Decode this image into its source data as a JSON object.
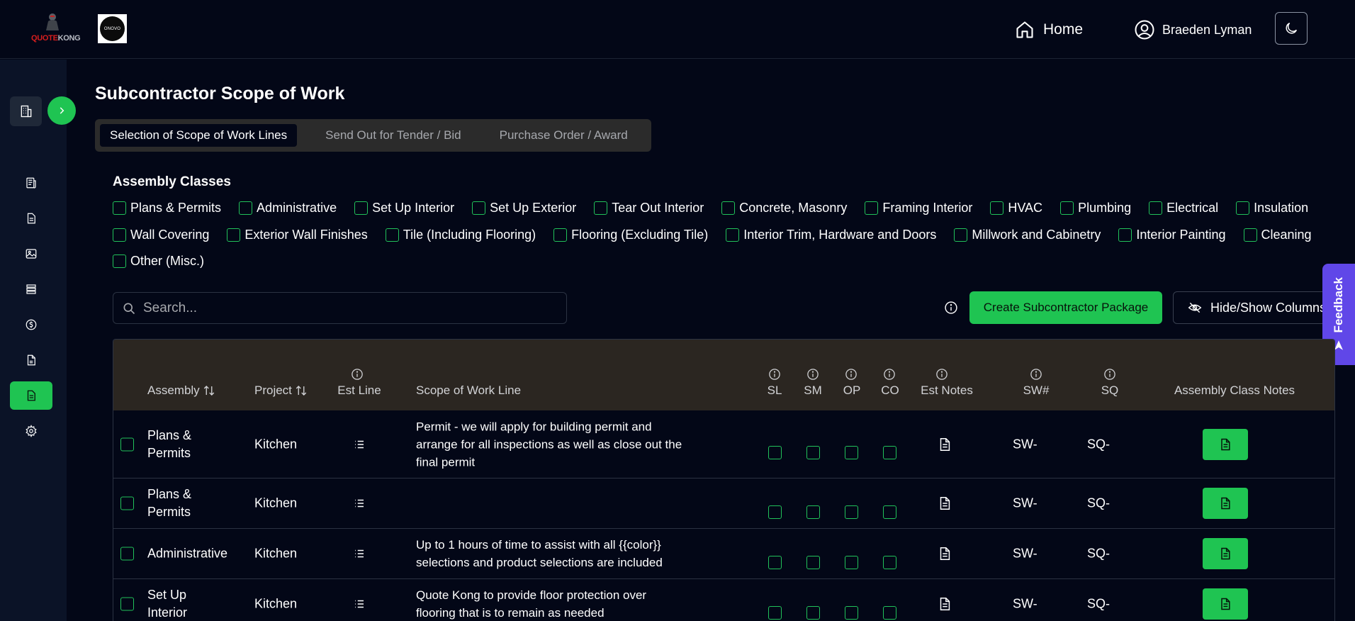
{
  "brand": {
    "logo_red": "QUOTE",
    "logo_gray": "KONG",
    "company_logo_text": "ONOVO"
  },
  "nav": {
    "home": "Home",
    "user": "Braeden Lyman"
  },
  "page": {
    "title": "Subcontractor Scope of Work"
  },
  "tabs": [
    "Selection of Scope of Work Lines",
    "Send Out for Tender / Bid",
    "Purchase Order / Award"
  ],
  "assembly_classes": {
    "title": "Assembly Classes",
    "rows": [
      [
        "Plans & Permits",
        "Administrative",
        "Set Up Interior",
        "Set Up Exterior",
        "Tear Out Interior",
        "Concrete, Masonry",
        "Framing Interior",
        "HVAC",
        "Plumbing",
        "Electrical",
        "Insulation"
      ],
      [
        "Wall Covering",
        "Exterior Wall Finishes",
        "Tile (Including Flooring)",
        "Flooring (Excluding Tile)",
        "Interior Trim, Hardware and Doors",
        "Millwork and Cabinetry",
        "Interior Painting",
        "Cleaning"
      ],
      [
        "Other (Misc.)"
      ]
    ]
  },
  "search": {
    "placeholder": "Search..."
  },
  "buttons": {
    "create": "Create Subcontractor Package",
    "columns": "Hide/Show Columns",
    "feedback": "Feedback"
  },
  "table": {
    "headers": {
      "assembly": "Assembly",
      "project": "Project",
      "est_line": "Est Line",
      "scope": "Scope of Work Line",
      "sl": "SL",
      "sm": "SM",
      "op": "OP",
      "co": "CO",
      "est_notes": "Est Notes",
      "sw": "SW#",
      "sq": "SQ",
      "class_notes": "Assembly Class Notes"
    },
    "rows": [
      {
        "assembly": "Plans & Permits",
        "project": "Kitchen",
        "scope": "Permit - we will apply for building permit and arrange for all inspections as well as close out the final permit",
        "sw": "SW-",
        "sq": "SQ-"
      },
      {
        "assembly": "Plans & Permits",
        "project": "Kitchen",
        "scope": "",
        "sw": "SW-",
        "sq": "SQ-"
      },
      {
        "assembly": "Administrative",
        "project": "Kitchen",
        "scope": "Up to 1 hours of time to assist with all {{color}} selections and product selections are included",
        "sw": "SW-",
        "sq": "SQ-"
      },
      {
        "assembly": "Set Up Interior",
        "project": "Kitchen",
        "scope": "Quote Kong to provide floor protection over flooring that is to remain as needed",
        "sw": "SW-",
        "sq": "SQ-"
      }
    ]
  },
  "colors": {
    "accent": "#1fc452",
    "background": "#030717",
    "sidebar": "#0b1327",
    "table_header": "#2b2621",
    "feedback": "#6047e8"
  }
}
